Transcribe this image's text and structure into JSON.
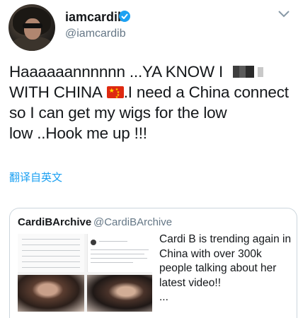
{
  "author": {
    "name": "iamcardib",
    "handle": "@iamcardib",
    "verified_color": "#1da1f2"
  },
  "tweet": {
    "line1": "Haaaaaannnnnn ...YA KNOW I",
    "line2a": "WITH CHINA",
    "line2b": ".I need a China connect",
    "line3": "so I can get my wigs for the low",
    "line4": "low ..Hook me up !!!"
  },
  "translate_label": "翻译自英文",
  "quoted": {
    "name": "CardiBArchive",
    "handle": "@CardiBArchive",
    "text": "Cardi B is trending again in China with over  300k people talking about her latest video!!",
    "ellipsis": "..."
  },
  "icons": {
    "menu": "chevron-down-icon",
    "verified": "verified-badge-icon",
    "flag": "china-flag-emoji"
  }
}
